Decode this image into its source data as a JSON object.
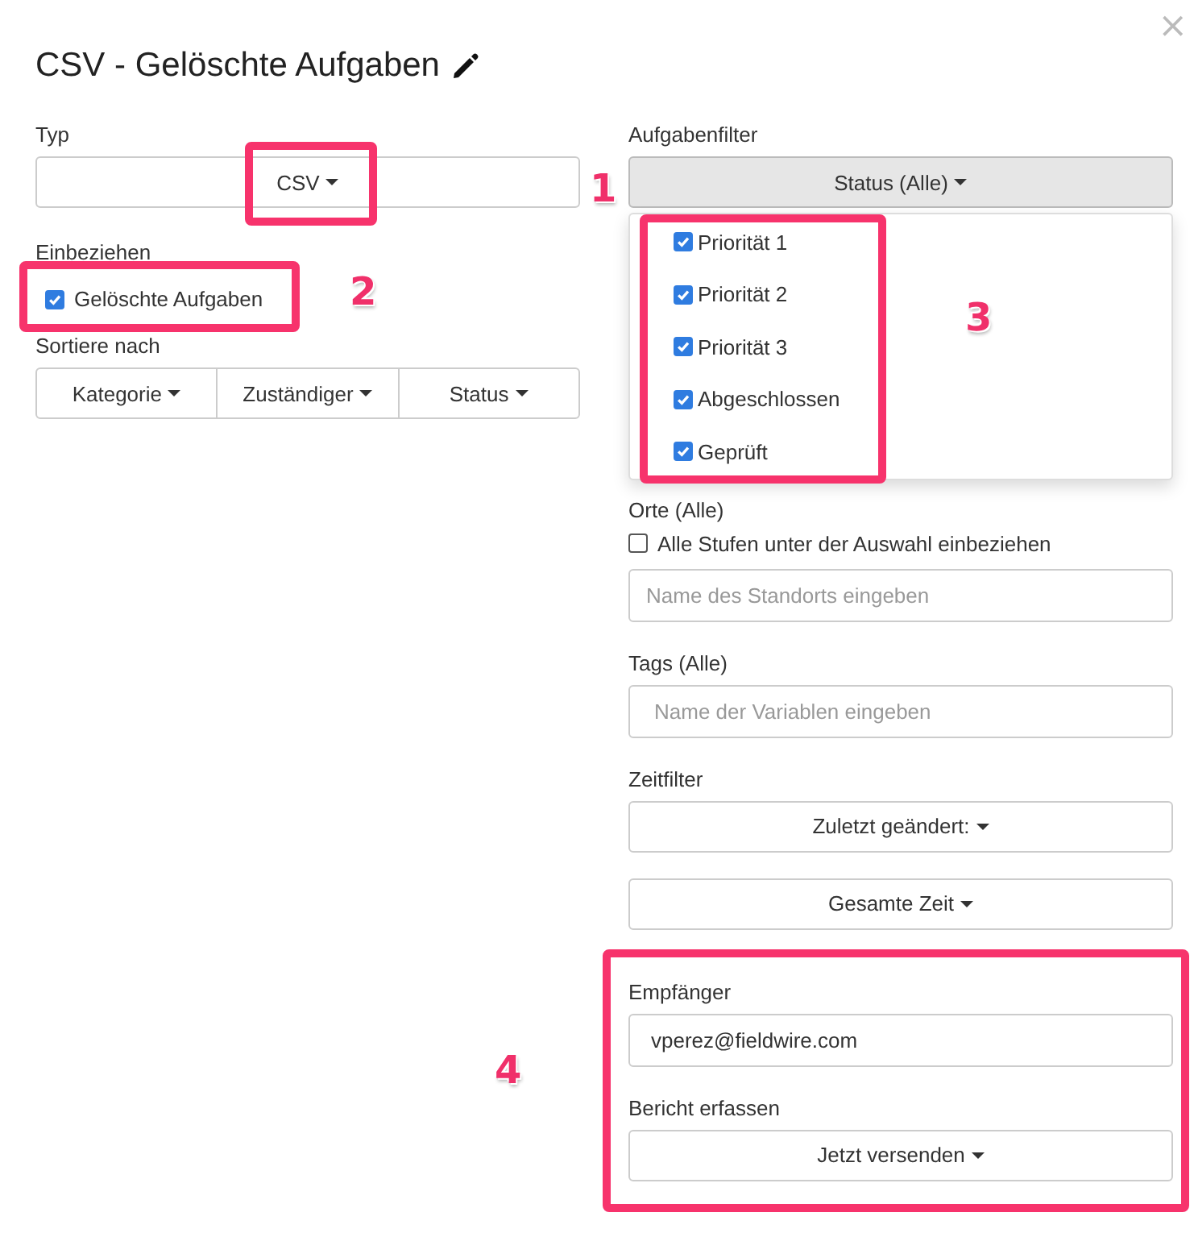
{
  "dialog": {
    "title": "CSV - Gelöschte Aufgaben",
    "close": "×"
  },
  "left": {
    "type": {
      "label": "Typ",
      "value": "CSV"
    },
    "include": {
      "label": "Einbeziehen",
      "options": [
        {
          "label": "Gelöschte Aufgaben",
          "checked": true
        }
      ]
    },
    "sort": {
      "label": "Sortiere nach",
      "buttons": [
        "Kategorie",
        "Zuständiger",
        "Status"
      ]
    }
  },
  "right": {
    "task_filter": {
      "label": "Aufgabenfilter",
      "button": "Status (Alle)",
      "expanded": true,
      "options": [
        {
          "label": "Priorität 1",
          "checked": true
        },
        {
          "label": "Priorität 2",
          "checked": true
        },
        {
          "label": "Priorität 3",
          "checked": true
        },
        {
          "label": "Abgeschlossen",
          "checked": true
        },
        {
          "label": "Geprüft",
          "checked": true
        }
      ]
    },
    "locations": {
      "label": "Orte (Alle)",
      "sublevels": {
        "label": "Alle Stufen unter der Auswahl einbeziehen",
        "checked": false
      },
      "placeholder": "Name des Standorts eingeben"
    },
    "tags": {
      "label": "Tags (Alle)",
      "placeholder": "Name der Variablen eingeben"
    },
    "time_filter": {
      "label": "Zeitfilter",
      "buttons": [
        "Zuletzt geändert:",
        "Gesamte Zeit"
      ]
    },
    "recipients": {
      "label": "Empfänger",
      "value": "vperez@fieldwire.com"
    },
    "report": {
      "label": "Bericht erfassen",
      "button": "Jetzt versenden"
    }
  },
  "annotations": [
    {
      "number": "1"
    },
    {
      "number": "2"
    },
    {
      "number": "3"
    },
    {
      "number": "4"
    }
  ]
}
